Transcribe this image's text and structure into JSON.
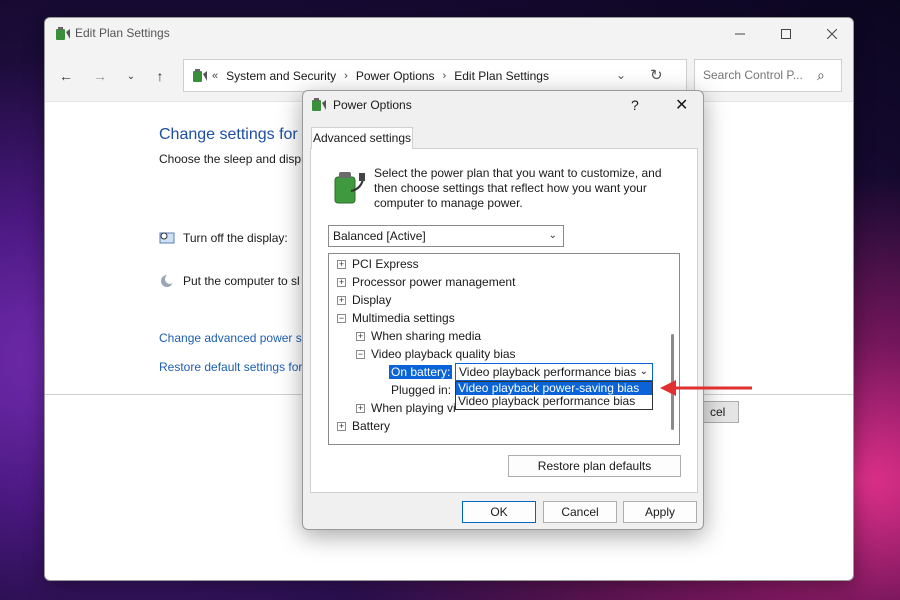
{
  "main_window": {
    "title": "Edit Plan Settings",
    "breadcrumb": [
      "System and Security",
      "Power Options",
      "Edit Plan Settings"
    ],
    "breadcrumb_prefix": "«",
    "search_placeholder": "Search Control P...",
    "heading": "Change settings for t",
    "subheading": "Choose the sleep and displ",
    "settings": [
      {
        "label": "Turn off the display:",
        "icon": "monitor-clock-icon"
      },
      {
        "label": "Put the computer to sl",
        "icon": "moon-icon"
      }
    ],
    "links": [
      "Change advanced power se",
      "Restore default settings for"
    ],
    "cancel_fragment": "cel"
  },
  "dialog": {
    "title": "Power Options",
    "help": "?",
    "tab": "Advanced settings",
    "intro": "Select the power plan that you want to customize, and then choose settings that reflect how you want your computer to manage power.",
    "plan": "Balanced [Active]",
    "tree": {
      "pci_express": "PCI Express",
      "processor": "Processor power management",
      "display": "Display",
      "multimedia": "Multimedia settings",
      "sharing_media": "When sharing media",
      "video_bias": "Video playback quality bias",
      "on_battery_label": "On battery:",
      "on_battery_value": "Video playback performance bias",
      "plugged_in_label": "Plugged in:",
      "playing_video": "When playing vi",
      "battery": "Battery"
    },
    "dropdown_options": [
      "Video playback power-saving bias",
      "Video playback performance bias"
    ],
    "restore_button": "Restore plan defaults",
    "ok": "OK",
    "cancel": "Cancel",
    "apply": "Apply"
  },
  "colors": {
    "accent": "#0a64d8",
    "link": "#1e5fb0",
    "arrow": "#e03030"
  }
}
